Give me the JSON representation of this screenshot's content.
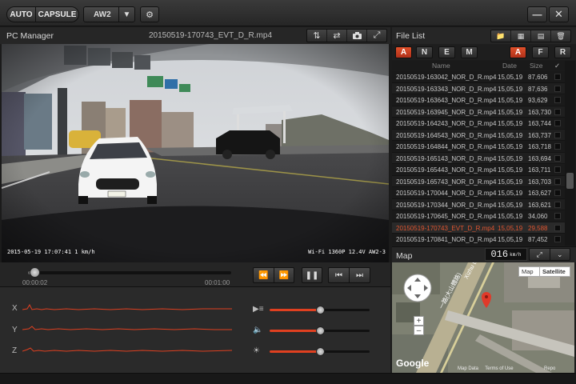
{
  "toolbar": {
    "mode_auto": "AUTO",
    "mode_capsule": "CAPSULE",
    "device": "AW2"
  },
  "pc_manager": {
    "title": "PC Manager",
    "filename": "20150519-170743_EVT_D_R.mp4"
  },
  "video": {
    "osd_left": "2015-05-19 17:07:41   1  km/h",
    "osd_right": "Wi-Fi 1360P 12.4V AW2-3"
  },
  "playback": {
    "current_time": "00:00:02",
    "total_time": "00:01:00",
    "progress": 0.03
  },
  "sensors": {
    "axes": [
      "X",
      "Y",
      "Z"
    ],
    "volume_level": 0.5,
    "speaker_level": 0.5,
    "brightness_level": 0.5,
    "accent": "#e04020"
  },
  "file_list": {
    "title": "File List",
    "filters_left": [
      "A",
      "N",
      "E",
      "M"
    ],
    "filters_right": [
      "A",
      "F",
      "R"
    ],
    "columns": {
      "name": "Name",
      "date": "Date",
      "size": "Size"
    },
    "rows": [
      {
        "name": "20150519-163042_NOR_D_R.mp4",
        "date": "15,05,19",
        "size": "87,606"
      },
      {
        "name": "20150519-163343_NOR_D_R.mp4",
        "date": "15,05,19",
        "size": "87,636"
      },
      {
        "name": "20150519-163643_NOR_D_R.mp4",
        "date": "15,05,19",
        "size": "93,629"
      },
      {
        "name": "20150519-163945_NOR_D_R.mp4",
        "date": "15,05,19",
        "size": "163,730"
      },
      {
        "name": "20150519-164243_NOR_D_R.mp4",
        "date": "15,05,19",
        "size": "163,744"
      },
      {
        "name": "20150519-164543_NOR_D_R.mp4",
        "date": "15,05,19",
        "size": "163,737"
      },
      {
        "name": "20150519-164844_NOR_D_R.mp4",
        "date": "15,05,19",
        "size": "163,718"
      },
      {
        "name": "20150519-165143_NOR_D_R.mp4",
        "date": "15,05,19",
        "size": "163,694"
      },
      {
        "name": "20150519-165443_NOR_D_R.mp4",
        "date": "15,05,19",
        "size": "163,711"
      },
      {
        "name": "20150519-165743_NOR_D_R.mp4",
        "date": "15,05,19",
        "size": "163,703"
      },
      {
        "name": "20150519-170044_NOR_D_R.mp4",
        "date": "15,05,19",
        "size": "163,627"
      },
      {
        "name": "20150519-170344_NOR_D_R.mp4",
        "date": "15,05,19",
        "size": "163,621"
      },
      {
        "name": "20150519-170645_NOR_D_R.mp4",
        "date": "15,05,19",
        "size": "34,060"
      },
      {
        "name": "20150519-170743_EVT_D_R.mp4",
        "date": "15,05,19",
        "size": "29,588",
        "selected": true
      },
      {
        "name": "20150519-170841_NOR_D_R.mp4",
        "date": "15,05,19",
        "size": "87,452"
      }
    ]
  },
  "map": {
    "title": "Map",
    "speed": "016",
    "speed_unit": "km/h",
    "type_map": "Map",
    "type_satellite": "Satellite",
    "street_1": "一路(大山體路)",
    "street_2": "Xizhu B",
    "google": "Google",
    "map_data": "Map Data",
    "terms": "Terms of Use",
    "report": "Repo"
  }
}
